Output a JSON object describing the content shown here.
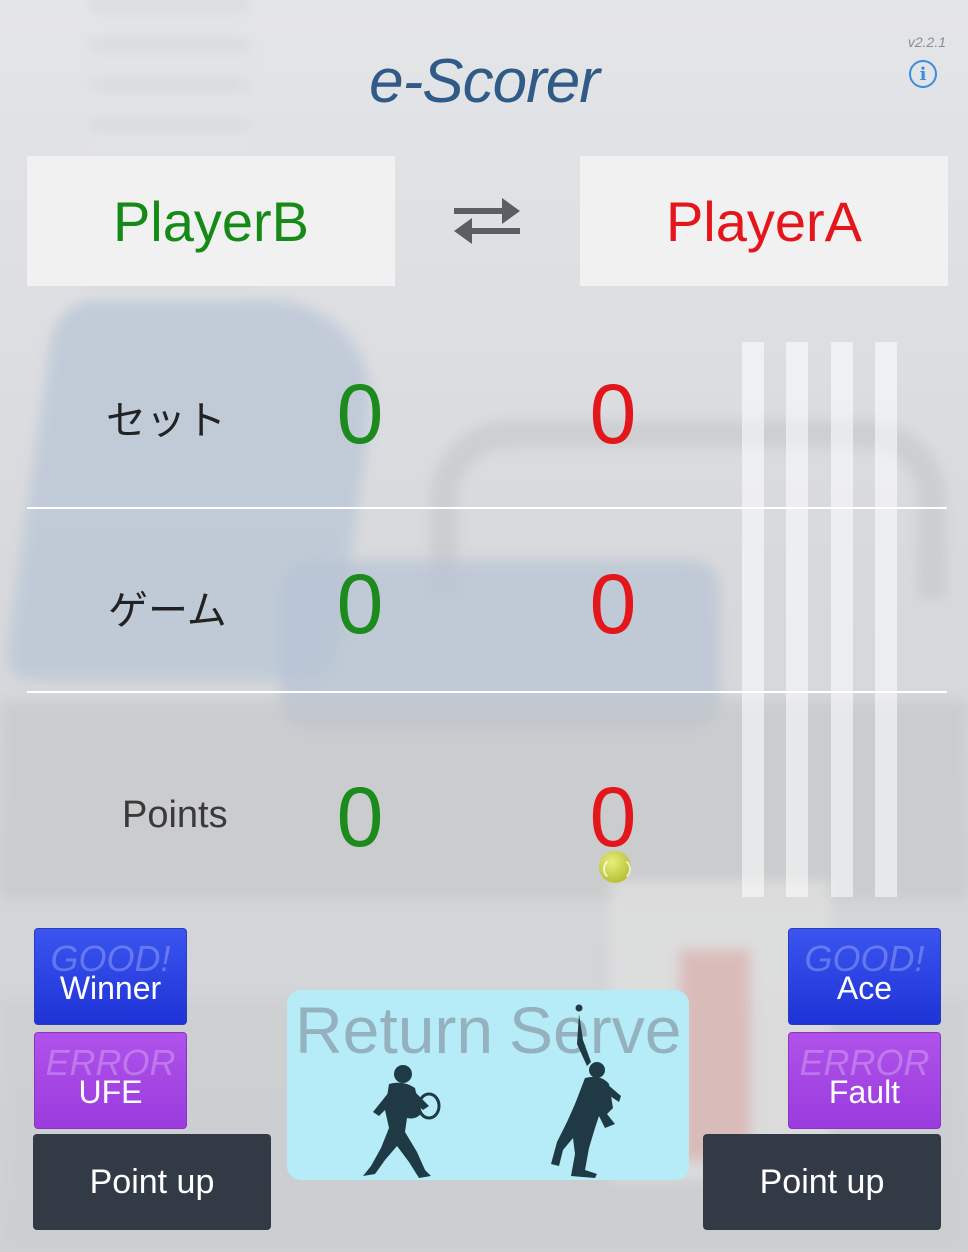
{
  "app": {
    "title": "e-Scorer",
    "version": "v2.2.1",
    "info_icon": "info-icon"
  },
  "players": {
    "left": "PlayerB",
    "right": "PlayerA",
    "swap_icon": "swap-arrows-icon"
  },
  "score_rows": [
    {
      "label": "セット",
      "left": "0",
      "right": "0"
    },
    {
      "label": "ゲーム",
      "left": "0",
      "right": "0"
    },
    {
      "label": "Points",
      "left": "0",
      "right": "0"
    }
  ],
  "left_controls": {
    "winner": {
      "overlay": "GOOD!",
      "label": "Winner"
    },
    "ufe": {
      "overlay": "ERROR",
      "label": "UFE"
    },
    "point_up": "Point up"
  },
  "right_controls": {
    "ace": {
      "overlay": "GOOD!",
      "label": "Ace"
    },
    "fault": {
      "overlay": "ERROR",
      "label": "Fault"
    },
    "point_up": "Point up"
  },
  "serve_panel": {
    "return_label": "Return",
    "serve_label": "Serve"
  },
  "colors": {
    "left_player": "#168a16",
    "right_player": "#e4161c",
    "title": "#2f5b86",
    "good": "#2a44e6",
    "error": "#a548e4",
    "point_up": "#323a46",
    "serve_panel": "#b6ecf8"
  }
}
